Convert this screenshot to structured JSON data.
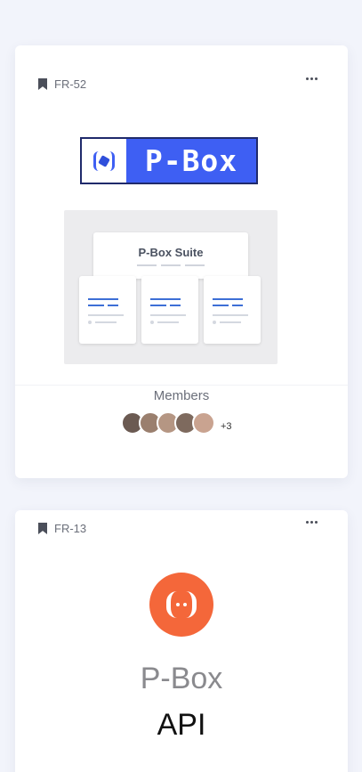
{
  "cards": [
    {
      "id": "FR-52",
      "logo_text": "P-Box",
      "preview_title": "P-Box Suite",
      "members_label": "Members",
      "members_more": "+3",
      "avatars": [
        {
          "color": "#6b5a52"
        },
        {
          "color": "#9a7f6e"
        },
        {
          "color": "#b59683"
        },
        {
          "color": "#7e6a5e"
        },
        {
          "color": "#c9a390"
        }
      ]
    },
    {
      "id": "FR-13",
      "title": "P-Box",
      "subtitle": "API",
      "icon_color": "#f4673a"
    }
  ],
  "colors": {
    "page_bg": "#f2f4fb",
    "brand_blue": "#3e5ff3",
    "api_orange": "#f4673a"
  },
  "icons": [
    "bookmark-icon",
    "more-horizontal-icon",
    "p-box-logo-icon",
    "api-logo-icon"
  ]
}
